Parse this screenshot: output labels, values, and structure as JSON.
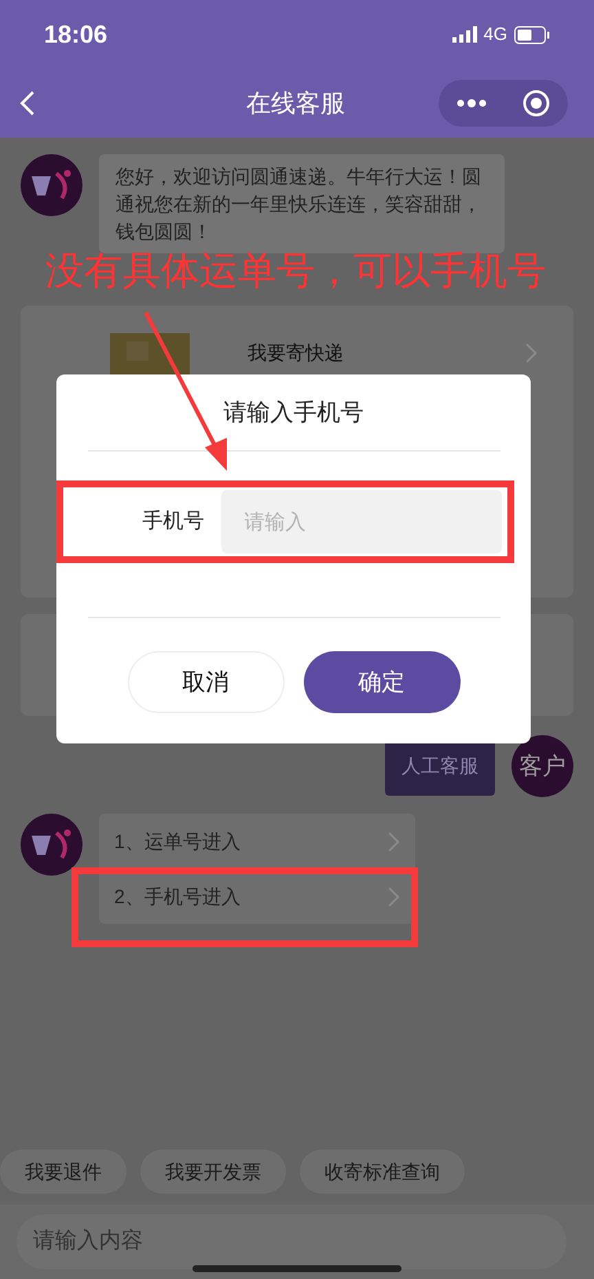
{
  "status_bar": {
    "time": "18:06",
    "network": "4G"
  },
  "nav": {
    "title": "在线客服"
  },
  "messages": [
    {
      "kind": "bot_text",
      "text": "您好，欢迎访问圆通速递。牛年行大运！圆通祝您在新的一年里快乐连连，笑容甜甜，钱包圆圆！"
    },
    {
      "kind": "card",
      "label": "我要寄快递"
    },
    {
      "kind": "blank_card"
    },
    {
      "kind": "user_text",
      "text": "人工客服",
      "avatar": "客户"
    },
    {
      "kind": "bot_options",
      "options": [
        "1、运单号进入",
        "2、手机号进入"
      ]
    }
  ],
  "quick_replies": [
    "我要退件",
    "我要开发票",
    "收寄标准查询"
  ],
  "input": {
    "placeholder": "请输入内容"
  },
  "dialog": {
    "title": "请输入手机号",
    "field_label": "手机号",
    "placeholder": "请输入",
    "buttons": [
      {
        "label": "取消",
        "kind": "cancel"
      },
      {
        "label": "确定",
        "kind": "confirm"
      }
    ]
  },
  "annotation": {
    "note": "没有具体运单号，可以手机号"
  }
}
